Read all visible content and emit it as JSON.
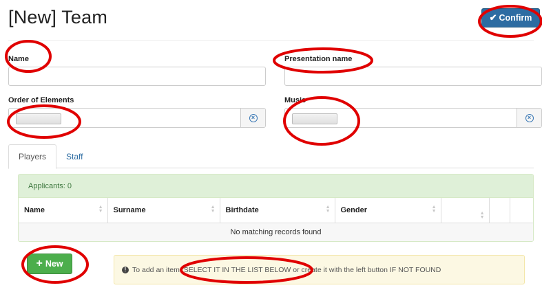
{
  "header": {
    "title": "[New] Team",
    "confirm_label": "Confirm",
    "confirm_icon": "check-icon"
  },
  "form": {
    "name_label": "Name",
    "name_value": "",
    "presentation_label": "Presentation name",
    "presentation_value": "",
    "order_label": "Order of Elements",
    "music_label": "Music"
  },
  "tabs": [
    {
      "label": "Players",
      "active": true
    },
    {
      "label": "Staff",
      "active": false
    }
  ],
  "panel": {
    "heading": "Applicants: 0",
    "columns": [
      "Name",
      "Surname",
      "Birthdate",
      "Gender",
      "",
      ""
    ],
    "empty_message": "No matching records found"
  },
  "actions": {
    "new_label": "New",
    "hint": "To add an item: SELECT IT IN THE LIST BELOW or create it with the left button IF NOT FOUND"
  },
  "colors": {
    "primary": "#2d6ca2",
    "success": "#4cae4c",
    "panel_header_bg": "#dff0d8",
    "alert_bg": "#fcf8e3",
    "annotation": "#e00000"
  }
}
